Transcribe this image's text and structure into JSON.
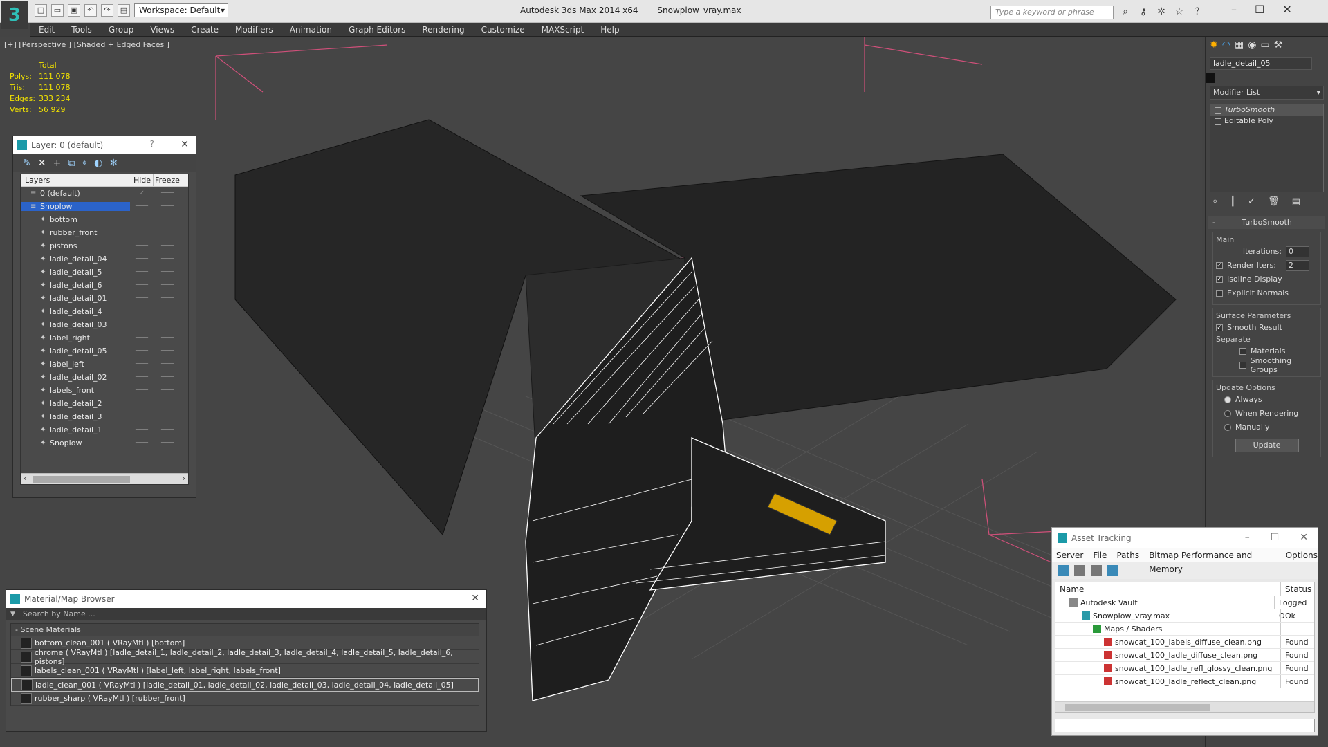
{
  "app": {
    "title": "Autodesk 3ds Max  2014 x64",
    "file": "Snowplow_vray.max",
    "workspace": "Workspace: Default",
    "search_placeholder": "Type a keyword or phrase"
  },
  "menu": [
    "Edit",
    "Tools",
    "Group",
    "Views",
    "Create",
    "Modifiers",
    "Animation",
    "Graph Editors",
    "Rendering",
    "Customize",
    "MAXScript",
    "Help"
  ],
  "viewport": {
    "label": "[+] [Perspective ] [Shaded + Edged Faces ]",
    "stats_header": "Total",
    "stats": [
      {
        "k": "Polys:",
        "v": "111 078"
      },
      {
        "k": "Tris:",
        "v": "111 078"
      },
      {
        "k": "Edges:",
        "v": "333 234"
      },
      {
        "k": "Verts:",
        "v": "56 929"
      }
    ]
  },
  "layer_panel": {
    "title": "Layer: 0 (default)",
    "help": "?",
    "col_layers": "Layers",
    "col_hide": "Hide",
    "col_freeze": "Freeze",
    "rows": [
      {
        "name": "0 (default)",
        "level": 1,
        "sel": false
      },
      {
        "name": "Snoplow",
        "level": 1,
        "sel": true
      },
      {
        "name": "bottom",
        "level": 2
      },
      {
        "name": "rubber_front",
        "level": 2
      },
      {
        "name": "pistons",
        "level": 2
      },
      {
        "name": "ladle_detail_04",
        "level": 2
      },
      {
        "name": "ladle_detail_5",
        "level": 2
      },
      {
        "name": "ladle_detail_6",
        "level": 2
      },
      {
        "name": "ladle_detail_01",
        "level": 2
      },
      {
        "name": "ladle_detail_4",
        "level": 2
      },
      {
        "name": "ladle_detail_03",
        "level": 2
      },
      {
        "name": "label_right",
        "level": 2
      },
      {
        "name": "ladle_detail_05",
        "level": 2
      },
      {
        "name": "label_left",
        "level": 2
      },
      {
        "name": "ladle_detail_02",
        "level": 2
      },
      {
        "name": "labels_front",
        "level": 2
      },
      {
        "name": "ladle_detail_2",
        "level": 2
      },
      {
        "name": "ladle_detail_3",
        "level": 2
      },
      {
        "name": "ladle_detail_1",
        "level": 2
      },
      {
        "name": "Snoplow",
        "level": 2
      }
    ]
  },
  "material_browser": {
    "title": "Material/Map Browser",
    "search": "Search by Name ...",
    "section": "- Scene Materials",
    "items": [
      "bottom_clean_001  ( VRayMtl ) [bottom]",
      "chrome  ( VRayMtl ) [ladle_detail_1, ladle_detail_2, ladle_detail_3, ladle_detail_4, ladle_detail_5, ladle_detail_6, pistons]",
      "labels_clean_001  ( VRayMtl ) [label_left, label_right, labels_front]",
      "ladle_clean_001  ( VRayMtl ) [ladle_detail_01, ladle_detail_02, ladle_detail_03, ladle_detail_04, ladle_detail_05]",
      "rubber_sharp  ( VRayMtl ) [rubber_front]"
    ]
  },
  "command_panel": {
    "object_name": "ladle_detail_05",
    "modifier_list": "Modifier List",
    "stack": [
      "TurboSmooth",
      "Editable Poly"
    ],
    "rollout_title": "TurboSmooth",
    "main_label": "Main",
    "iterations_label": "Iterations:",
    "iterations_value": "0",
    "render_iters_label": "Render Iters:",
    "render_iters_value": "2",
    "isoline": "Isoline Display",
    "explicit": "Explicit Normals",
    "surface_label": "Surface Parameters",
    "smooth_result": "Smooth Result",
    "separate_label": "Separate",
    "materials": "Materials",
    "smoothing_groups": "Smoothing Groups",
    "update_label": "Update Options",
    "always": "Always",
    "when_rendering": "When Rendering",
    "manually": "Manually",
    "update_btn": "Update"
  },
  "asset_tracking": {
    "title": "Asset Tracking",
    "menu": [
      "Server",
      "File",
      "Paths",
      "Bitmap Performance and Memory",
      "Options"
    ],
    "col_name": "Name",
    "col_status": "Status",
    "rows": [
      {
        "name": "Autodesk Vault",
        "status": "Logged O",
        "indent": 20
      },
      {
        "name": "Snowplow_vray.max",
        "status": "Ok",
        "indent": 38
      },
      {
        "name": "Maps / Shaders",
        "status": "",
        "indent": 54
      },
      {
        "name": "snowcat_100_labels_diffuse_clean.png",
        "status": "Found",
        "indent": 70
      },
      {
        "name": "snowcat_100_ladle_diffuse_clean.png",
        "status": "Found",
        "indent": 70
      },
      {
        "name": "snowcat_100_ladle_refl_glossy_clean.png",
        "status": "Found",
        "indent": 70
      },
      {
        "name": "snowcat_100_ladle_reflect_clean.png",
        "status": "Found",
        "indent": 70
      }
    ]
  }
}
